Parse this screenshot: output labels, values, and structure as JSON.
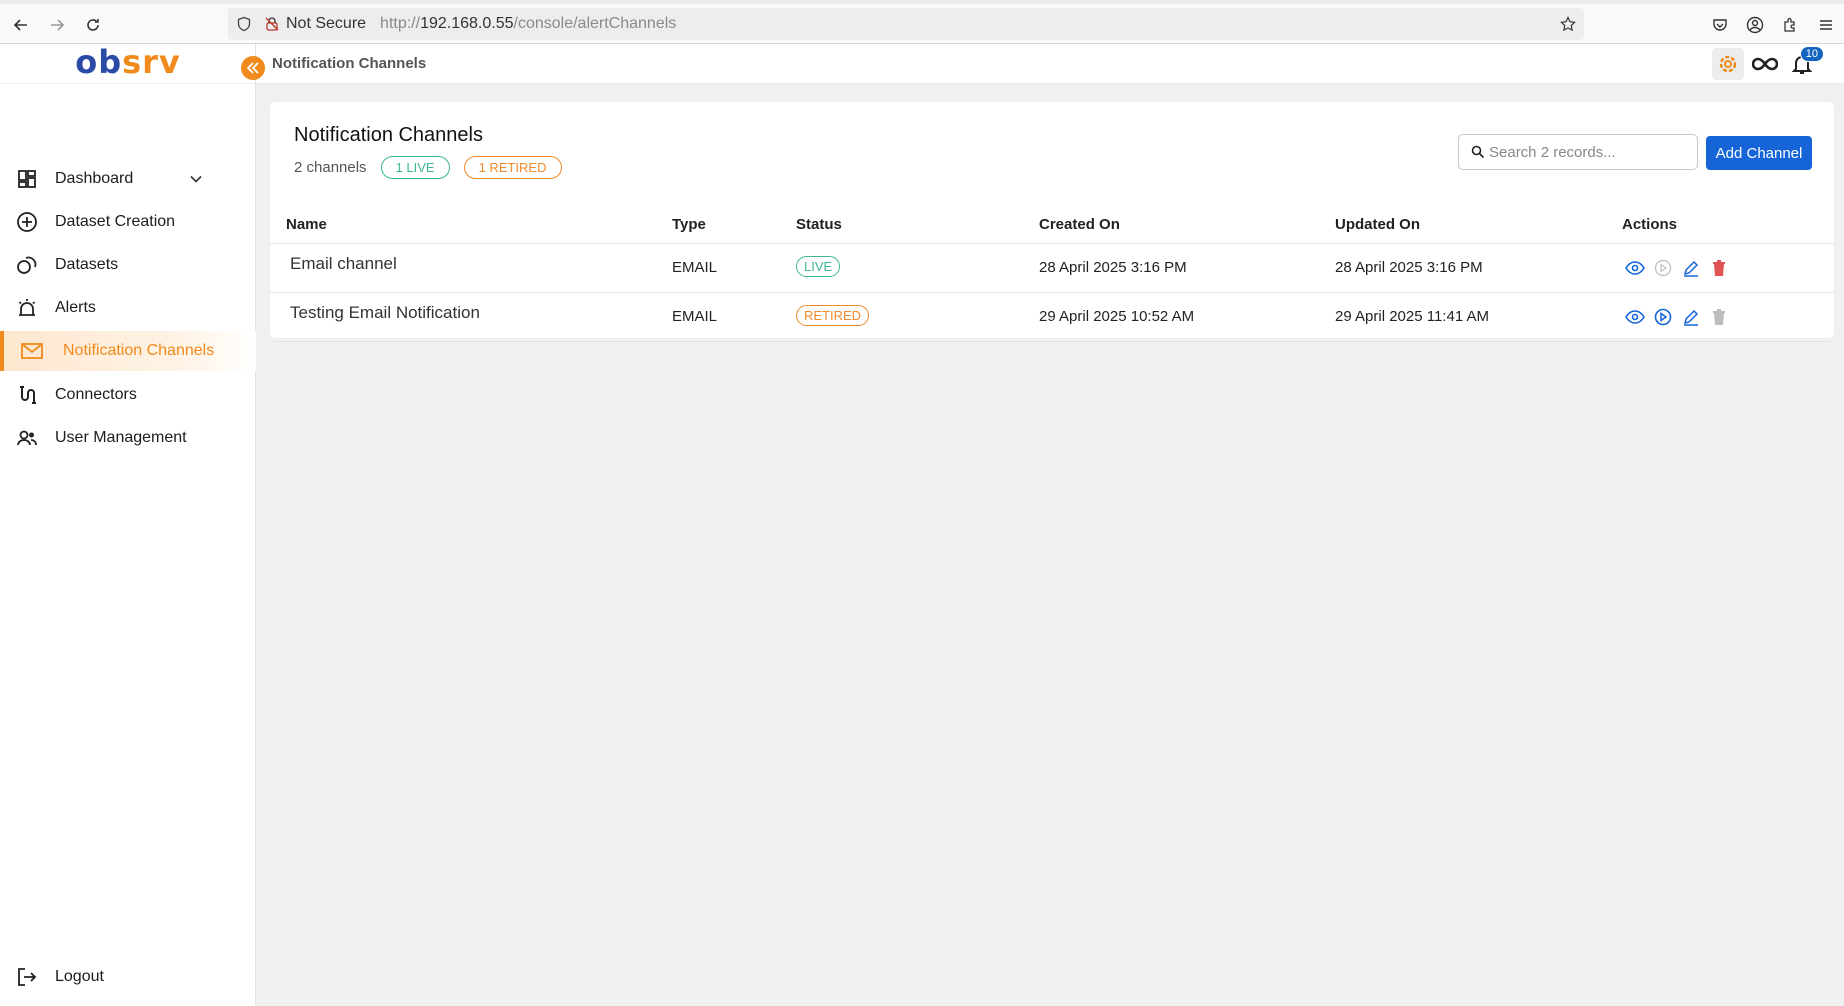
{
  "browser": {
    "not_secure_label": "Not Secure",
    "url_prefix": "http://",
    "url_host": "192.168.0.55",
    "url_path": "/console/alertChannels"
  },
  "logo": {
    "part1": "ob",
    "part2": "srv"
  },
  "sidebar": {
    "items": [
      {
        "label": "Dashboard"
      },
      {
        "label": "Dataset Creation"
      },
      {
        "label": "Datasets"
      },
      {
        "label": "Alerts"
      },
      {
        "label": "Notification Channels"
      },
      {
        "label": "Connectors"
      },
      {
        "label": "User Management"
      }
    ],
    "logout_label": "Logout"
  },
  "header": {
    "title": "Notification Channels",
    "notification_count": "10"
  },
  "page": {
    "title": "Notification Channels",
    "count_label": "2 channels",
    "live_chip": "1 LIVE",
    "retired_chip": "1 RETIRED",
    "search_placeholder": "Search 2 records...",
    "add_button": "Add Channel"
  },
  "table": {
    "columns": [
      "Name",
      "Type",
      "Status",
      "Created On",
      "Updated On",
      "Actions"
    ],
    "rows": [
      {
        "name": "Email channel",
        "type": "EMAIL",
        "status": "LIVE",
        "created": "28 April 2025 3:16 PM",
        "updated": "28 April 2025 3:16 PM"
      },
      {
        "name": "Testing Email Notification",
        "type": "EMAIL",
        "status": "RETIRED",
        "created": "29 April 2025 10:52 AM",
        "updated": "29 April 2025 11:41 AM"
      }
    ]
  },
  "colors": {
    "accent": "#f08a1c",
    "primary": "#1565d8",
    "live": "#3fb59a",
    "retired": "#ef8a2c",
    "danger": "#e05353"
  }
}
